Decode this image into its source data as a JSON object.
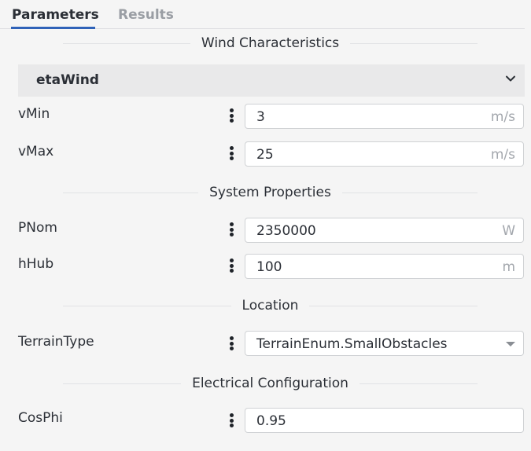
{
  "tabs": [
    {
      "label": "Parameters",
      "active": true
    },
    {
      "label": "Results",
      "active": false
    }
  ],
  "sections": {
    "wind": "Wind Characteristics",
    "system": "System Properties",
    "location": "Location",
    "electrical": "Electrical Configuration"
  },
  "dropdown": {
    "label": "etaWind",
    "icon": "chevron-down-icon"
  },
  "params": {
    "vMin": {
      "label": "vMin",
      "value": "3",
      "unit": "m/s"
    },
    "vMax": {
      "label": "vMax",
      "value": "25",
      "unit": "m/s"
    },
    "PNom": {
      "label": "PNom",
      "value": "2350000",
      "unit": "W"
    },
    "hHub": {
      "label": "hHub",
      "value": "100",
      "unit": "m"
    },
    "TerrainType": {
      "label": "TerrainType",
      "value": "TerrainEnum.SmallObstacles"
    },
    "CosPhi": {
      "label": "CosPhi",
      "value": "0.95"
    }
  },
  "colors": {
    "accent": "#2f62b8",
    "background": "#f5f5f5",
    "field_border": "#cfd1d4"
  }
}
